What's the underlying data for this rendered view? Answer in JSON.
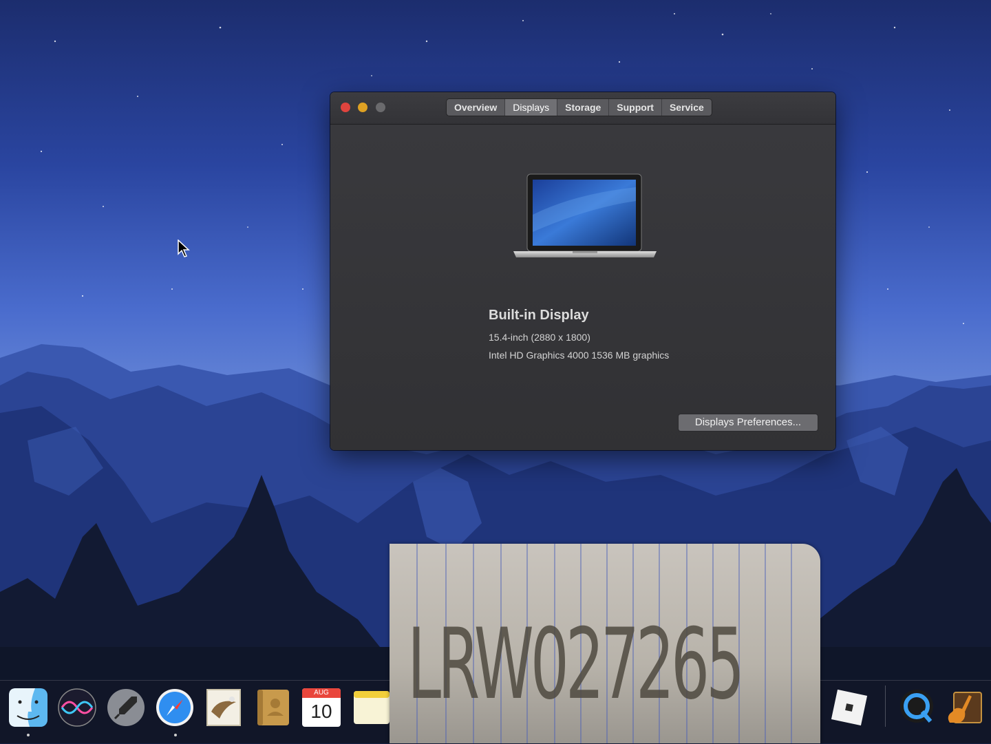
{
  "window": {
    "tabs": [
      {
        "label": "Overview",
        "active": false
      },
      {
        "label": "Displays",
        "active": true
      },
      {
        "label": "Storage",
        "active": false
      },
      {
        "label": "Support",
        "active": false
      },
      {
        "label": "Service",
        "active": false
      }
    ],
    "display": {
      "title": "Built-in Display",
      "size": "15.4-inch (2880 x 1800)",
      "graphics": "Intel HD Graphics 4000 1536 MB graphics"
    },
    "button_label": "Displays Preferences..."
  },
  "dock": {
    "items": [
      {
        "name": "Finder",
        "icon": "finder-icon",
        "running": true
      },
      {
        "name": "Siri",
        "icon": "siri-icon",
        "running": false
      },
      {
        "name": "Launchpad",
        "icon": "launchpad-icon",
        "running": false
      },
      {
        "name": "Safari",
        "icon": "safari-icon",
        "running": true
      },
      {
        "name": "Mail",
        "icon": "mail-icon",
        "running": false
      },
      {
        "name": "Contacts",
        "icon": "contacts-icon",
        "running": false
      },
      {
        "name": "Calendar",
        "icon": "calendar-icon",
        "running": false
      },
      {
        "name": "Notes",
        "icon": "notes-icon",
        "running": false
      },
      {
        "name": "Roblox",
        "icon": "roblox-icon",
        "running": false
      },
      {
        "name": "QuickTime Player",
        "icon": "quicktime-icon",
        "running": false
      },
      {
        "name": "GarageBand",
        "icon": "garageband-icon",
        "running": false
      }
    ],
    "calendar": {
      "month": "AUG",
      "day": "10"
    }
  },
  "note": {
    "text": "LRW027265"
  },
  "colors": {
    "close": "#e0443e",
    "minimize": "#dea123",
    "zoom": "#6a6a6d",
    "window_bg": "#333337",
    "tab_active": "#707074"
  }
}
